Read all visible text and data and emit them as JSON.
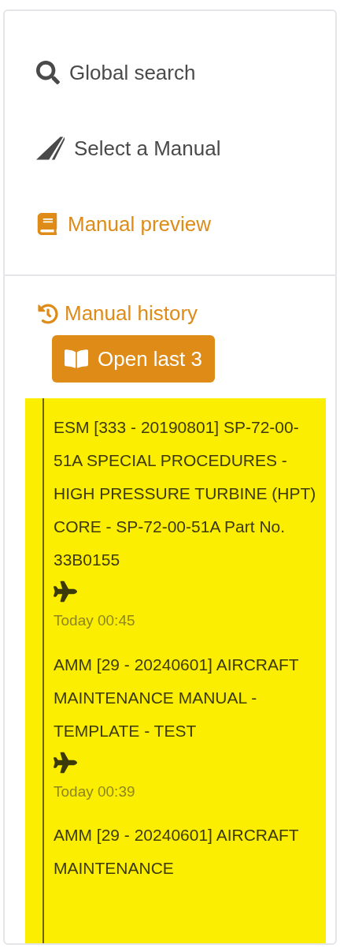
{
  "nav": [
    {
      "kind": "search",
      "label": "Global search",
      "selected": false
    },
    {
      "kind": "manual",
      "label": "Select a Manual",
      "selected": false
    },
    {
      "kind": "preview",
      "label": "Manual preview",
      "selected": true
    }
  ],
  "history": {
    "title": "Manual history",
    "open_button": "Open last 3",
    "entries": [
      {
        "title": "ESM [333 - 20190801] SP-72-00-51A SPECIAL PROCEDURES - HIGH PRESSURE TURBINE (HPT) CORE - SP-72-00-51A Part No. 33B0155",
        "time": "Today 00:45"
      },
      {
        "title": "AMM [29 - 20240601] AIRCRAFT MAINTENANCE MANUAL - TEMPLATE - TEST",
        "time": "Today 00:39"
      },
      {
        "title": "AMM [29 - 20240601] AIRCRAFT MAINTENANCE"
      }
    ]
  }
}
